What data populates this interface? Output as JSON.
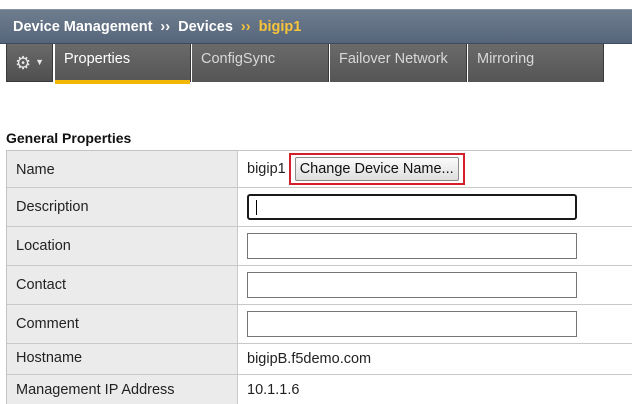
{
  "breadcrumb": {
    "items": [
      "Device Management",
      "Devices",
      "bigip1"
    ],
    "separator": "››"
  },
  "toolbar": {
    "gear_icon": "gear-icon",
    "caret_icon": "caret-down-icon"
  },
  "tabs": [
    {
      "label": "Properties",
      "active": true
    },
    {
      "label": "ConfigSync",
      "active": false
    },
    {
      "label": "Failover Network",
      "active": false
    },
    {
      "label": "Mirroring",
      "active": false
    }
  ],
  "section": {
    "title": "General Properties"
  },
  "properties": {
    "name": {
      "label": "Name",
      "value": "bigip1",
      "button": "Change Device Name..."
    },
    "description": {
      "label": "Description",
      "value": ""
    },
    "location": {
      "label": "Location",
      "value": ""
    },
    "contact": {
      "label": "Contact",
      "value": ""
    },
    "comment": {
      "label": "Comment",
      "value": ""
    },
    "hostname": {
      "label": "Hostname",
      "value": "bigipB.f5demo.com"
    },
    "mgmt_ip": {
      "label": "Management IP Address",
      "value": "10.1.1.6"
    }
  },
  "colors": {
    "breadcrumb_current": "#f7c43a",
    "tab_active_underline": "#f2b705",
    "highlight_box": "#d4202a"
  }
}
